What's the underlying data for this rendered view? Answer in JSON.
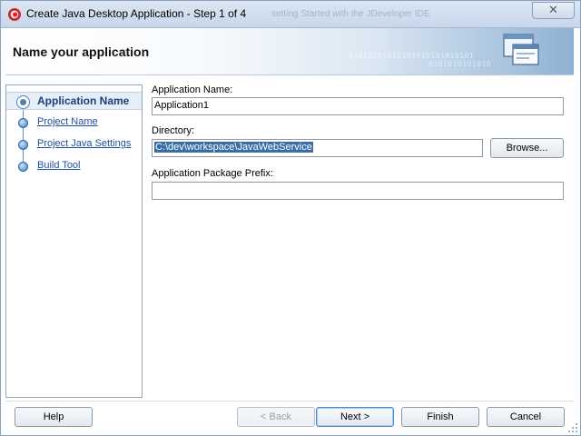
{
  "window": {
    "title": "Create Java Desktop Application - Step 1 of 4",
    "background_title": "setting Started with the JDeveloper IDE",
    "close_label": "✕"
  },
  "header": {
    "title": "Name your application",
    "binary_line1": "01010101010101010101010101",
    "binary_line2": "0101010101010"
  },
  "steps": [
    {
      "label": "Application Name",
      "active": true
    },
    {
      "label": "Project Name",
      "active": false
    },
    {
      "label": "Project Java Settings",
      "active": false
    },
    {
      "label": "Build Tool",
      "active": false
    }
  ],
  "form": {
    "app_name_label": "Application Name:",
    "app_name_value": "Application1",
    "directory_label": "Directory:",
    "directory_value": "C:\\dev\\workspace\\JavaWebService",
    "browse_label": "Browse...",
    "package_label": "Application Package Prefix:",
    "package_value": ""
  },
  "buttons": {
    "help": "Help",
    "back": "< Back",
    "next": "Next >",
    "finish": "Finish",
    "cancel": "Cancel"
  },
  "colors": {
    "accent": "#3a6ea5",
    "link": "#1c4fa3",
    "header_gradient_end": "#8fb2d4"
  }
}
